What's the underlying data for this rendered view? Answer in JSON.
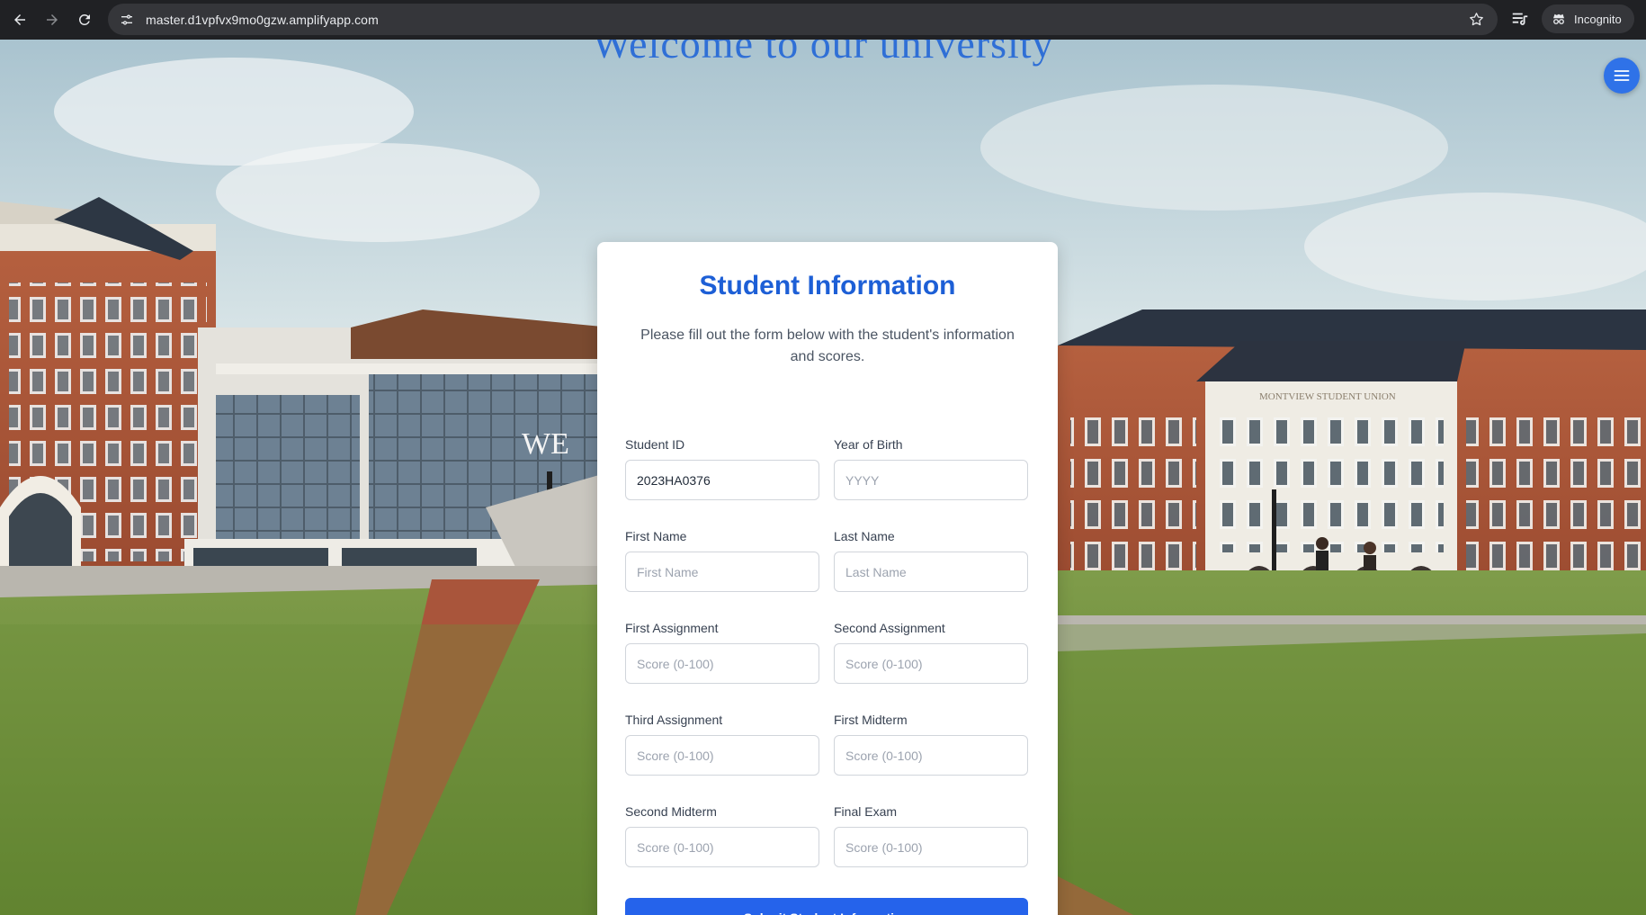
{
  "browser": {
    "url": "master.d1vpfvx9mo0gzw.amplifyapp.com",
    "incognito_label": "Incognito",
    "icons": [
      "back-icon",
      "forward-icon",
      "reload-icon",
      "site-info-icon",
      "star-icon",
      "reading-list-icon",
      "incognito-icon"
    ]
  },
  "hero": {
    "title": "Welcome to our university"
  },
  "menu": {
    "icon": "hamburger-menu-icon",
    "color": "#2f72e8"
  },
  "form": {
    "title": "Student Information",
    "subtitle": "Please fill out the form below with the student's information and scores.",
    "fields": {
      "student_id": {
        "label": "Student ID",
        "value": "2023HA0376",
        "placeholder": ""
      },
      "year_of_birth": {
        "label": "Year of Birth",
        "value": "",
        "placeholder": "YYYY"
      },
      "first_name": {
        "label": "First Name",
        "value": "",
        "placeholder": "First Name"
      },
      "last_name": {
        "label": "Last Name",
        "value": "",
        "placeholder": "Last Name"
      },
      "first_assignment": {
        "label": "First Assignment",
        "value": "",
        "placeholder": "Score (0-100)"
      },
      "second_assignment": {
        "label": "Second Assignment",
        "value": "",
        "placeholder": "Score (0-100)"
      },
      "third_assignment": {
        "label": "Third Assignment",
        "value": "",
        "placeholder": "Score (0-100)"
      },
      "first_midterm": {
        "label": "First Midterm",
        "value": "",
        "placeholder": "Score (0-100)"
      },
      "second_midterm": {
        "label": "Second Midterm",
        "value": "",
        "placeholder": "Score (0-100)"
      },
      "final_exam": {
        "label": "Final Exam",
        "value": "",
        "placeholder": "Score (0-100)"
      }
    },
    "submit_label": "Submit Student Information",
    "accent_color": "#2563eb"
  },
  "scene": {
    "building_sign": "MONTVIEW STUDENT UNION",
    "glass_sign": "WE"
  }
}
